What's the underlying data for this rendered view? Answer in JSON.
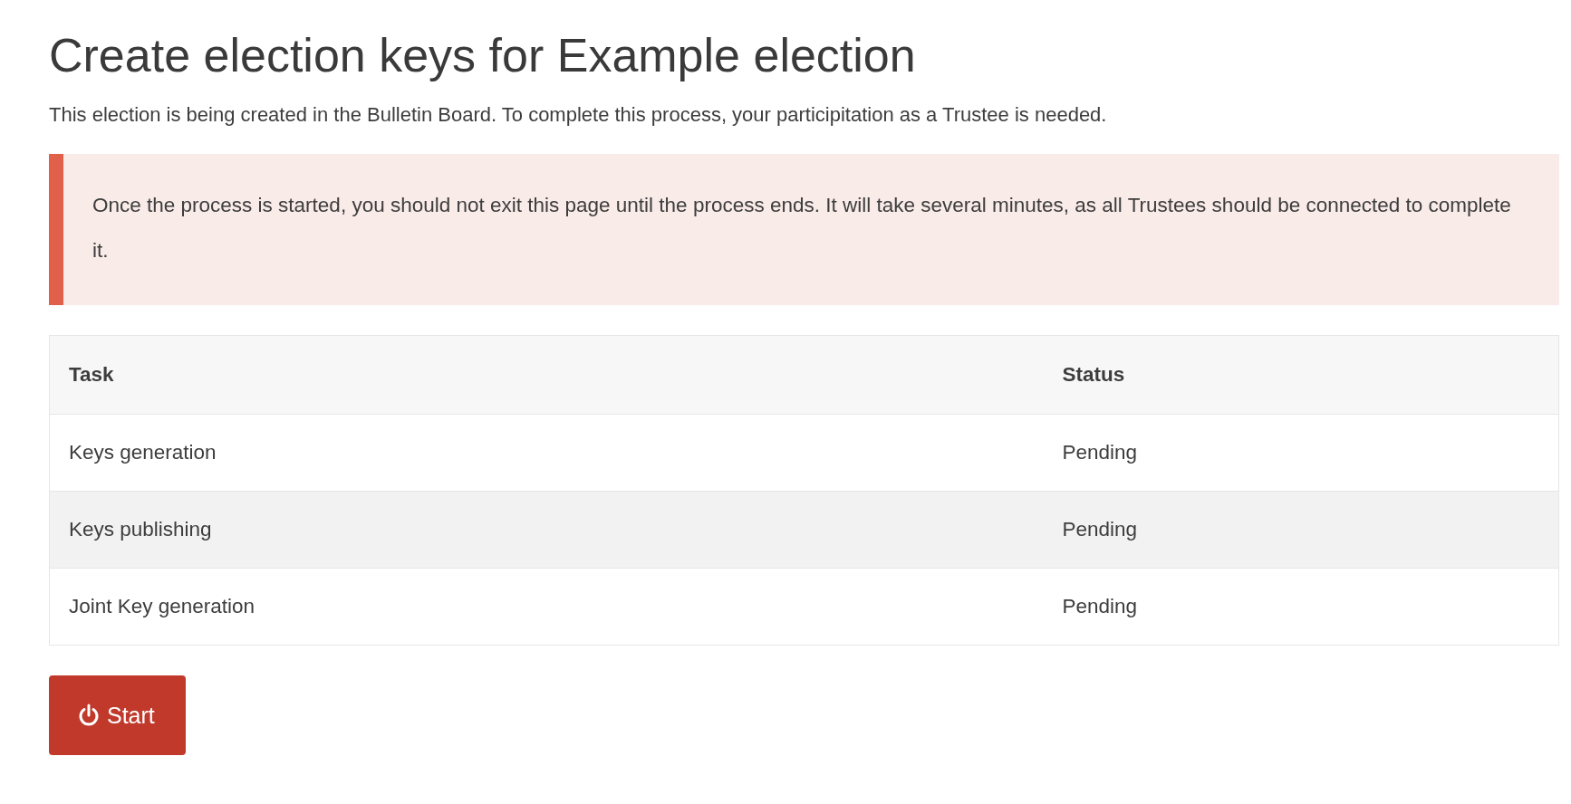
{
  "title": "Create election keys for Example election",
  "intro": "This election is being created in the Bulletin Board. To complete this process, your participitation as a Trustee is needed.",
  "callout": {
    "text": "Once the process is started, you should not exit this page until the process ends. It will take several minutes, as all Trustees should be connected to complete it."
  },
  "table": {
    "columns": [
      "Task",
      "Status"
    ],
    "rows": [
      {
        "task": "Keys generation",
        "status": "Pending"
      },
      {
        "task": "Keys publishing",
        "status": "Pending"
      },
      {
        "task": "Joint Key generation",
        "status": "Pending"
      }
    ]
  },
  "button": {
    "label": "Start"
  }
}
